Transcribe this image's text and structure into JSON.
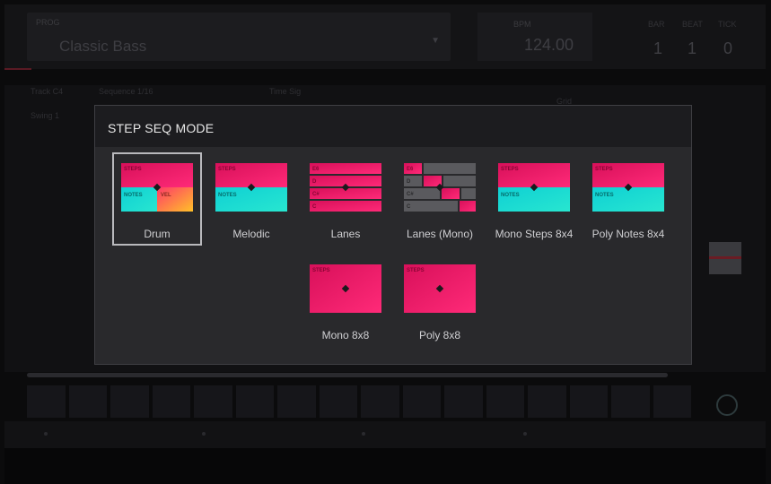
{
  "background": {
    "program_label": "PROG",
    "program_name": "Classic Bass",
    "bpm_label": "BPM",
    "bpm_value": "124.00",
    "position_labels": [
      "BAR",
      "BEAT",
      "TICK"
    ],
    "position_values": [
      "1",
      "1",
      "0"
    ],
    "row_labels": [
      "Track  C4",
      "Swing  1",
      "Sequence 1/16",
      "Time Sig",
      "Grid"
    ]
  },
  "modal": {
    "title": "STEP SEQ MODE",
    "modes": [
      {
        "name": "Drum",
        "selected": true,
        "labels": [
          "STEPS",
          "NOTES",
          "VEL"
        ]
      },
      {
        "name": "Melodic",
        "selected": false,
        "labels": [
          "STEPS",
          "NOTES"
        ]
      },
      {
        "name": "Lanes",
        "selected": false,
        "labels": [
          "E6",
          "D",
          "C#",
          "C"
        ]
      },
      {
        "name": "Lanes (Mono)",
        "selected": false,
        "labels": [
          "E6",
          "D",
          "C#",
          "C"
        ]
      },
      {
        "name": "Mono Steps 8x4",
        "selected": false,
        "labels": [
          "STEPS",
          "NOTES"
        ]
      },
      {
        "name": "Poly Notes 8x4",
        "selected": false,
        "labels": [
          "STEPS",
          "NOTES"
        ]
      },
      {
        "name": "Mono 8x8",
        "selected": false,
        "labels": [
          "STEPS"
        ]
      },
      {
        "name": "Poly 8x8",
        "selected": false,
        "labels": [
          "STEPS"
        ]
      }
    ]
  },
  "colors": {
    "magenta": "#e8105e",
    "cyan": "#18dcd8",
    "orange": "#ff9a28",
    "gray": "#5a5a5e",
    "selection": "#b9b9bd"
  }
}
